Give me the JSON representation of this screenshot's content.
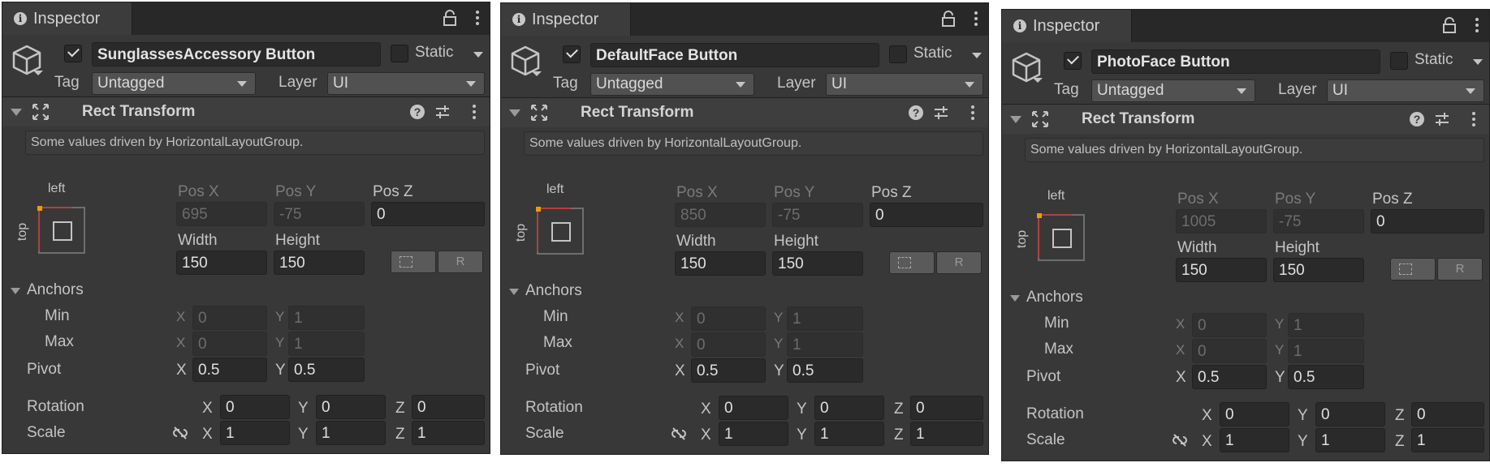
{
  "panels": [
    {
      "tab_title": "Inspector",
      "object_name": "SunglassesAccessory Button",
      "active": true,
      "static_label": "Static",
      "tag_label": "Tag",
      "tag_value": "Untagged",
      "layer_label": "Layer",
      "layer_value": "UI",
      "component_title": "Rect Transform",
      "driven_note": "Some values driven by HorizontalLayoutGroup.",
      "anchor_h": "left",
      "anchor_v": "top",
      "pos_x_label": "Pos X",
      "pos_x": "695",
      "pos_y_label": "Pos Y",
      "pos_y": "-75",
      "pos_z_label": "Pos Z",
      "pos_z": "0",
      "width_label": "Width",
      "width": "150",
      "height_label": "Height",
      "height": "150",
      "r_button": "R",
      "anchors_label": "Anchors",
      "min_label": "Min",
      "min_x": "0",
      "min_y": "1",
      "max_label": "Max",
      "max_x": "0",
      "max_y": "1",
      "pivot_label": "Pivot",
      "pivot_x": "0.5",
      "pivot_y": "0.5",
      "rotation_label": "Rotation",
      "rot_x": "0",
      "rot_y": "0",
      "rot_z": "0",
      "scale_label": "Scale",
      "scale_x": "1",
      "scale_y": "1",
      "scale_z": "1",
      "x": "X",
      "y": "Y",
      "z": "Z"
    },
    {
      "tab_title": "Inspector",
      "object_name": "DefaultFace Button",
      "active": true,
      "static_label": "Static",
      "tag_label": "Tag",
      "tag_value": "Untagged",
      "layer_label": "Layer",
      "layer_value": "UI",
      "component_title": "Rect Transform",
      "driven_note": "Some values driven by HorizontalLayoutGroup.",
      "anchor_h": "left",
      "anchor_v": "top",
      "pos_x_label": "Pos X",
      "pos_x": "850",
      "pos_y_label": "Pos Y",
      "pos_y": "-75",
      "pos_z_label": "Pos Z",
      "pos_z": "0",
      "width_label": "Width",
      "width": "150",
      "height_label": "Height",
      "height": "150",
      "r_button": "R",
      "anchors_label": "Anchors",
      "min_label": "Min",
      "min_x": "0",
      "min_y": "1",
      "max_label": "Max",
      "max_x": "0",
      "max_y": "1",
      "pivot_label": "Pivot",
      "pivot_x": "0.5",
      "pivot_y": "0.5",
      "rotation_label": "Rotation",
      "rot_x": "0",
      "rot_y": "0",
      "rot_z": "0",
      "scale_label": "Scale",
      "scale_x": "1",
      "scale_y": "1",
      "scale_z": "1",
      "x": "X",
      "y": "Y",
      "z": "Z"
    },
    {
      "tab_title": "Inspector",
      "object_name": "PhotoFace Button",
      "active": true,
      "static_label": "Static",
      "tag_label": "Tag",
      "tag_value": "Untagged",
      "layer_label": "Layer",
      "layer_value": "UI",
      "component_title": "Rect Transform",
      "driven_note": "Some values driven by HorizontalLayoutGroup.",
      "anchor_h": "left",
      "anchor_v": "top",
      "pos_x_label": "Pos X",
      "pos_x": "1005",
      "pos_y_label": "Pos Y",
      "pos_y": "-75",
      "pos_z_label": "Pos Z",
      "pos_z": "0",
      "width_label": "Width",
      "width": "150",
      "height_label": "Height",
      "height": "150",
      "r_button": "R",
      "anchors_label": "Anchors",
      "min_label": "Min",
      "min_x": "0",
      "min_y": "1",
      "max_label": "Max",
      "max_x": "0",
      "max_y": "1",
      "pivot_label": "Pivot",
      "pivot_x": "0.5",
      "pivot_y": "0.5",
      "rotation_label": "Rotation",
      "rot_x": "0",
      "rot_y": "0",
      "rot_z": "0",
      "scale_label": "Scale",
      "scale_x": "1",
      "scale_y": "1",
      "scale_z": "1",
      "x": "X",
      "y": "Y",
      "z": "Z"
    }
  ],
  "colors": {
    "panel_bg": "#383838",
    "tab_bar_bg": "#282828",
    "field_bg": "#2a2a2a",
    "anchor_accent": "#e8a000",
    "anchor_red": "#b04040"
  }
}
